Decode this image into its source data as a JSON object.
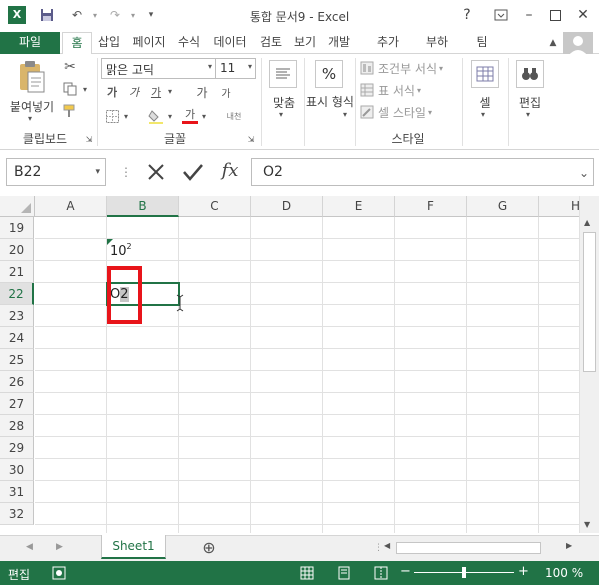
{
  "window": {
    "title": "통합 문서9 - Excel",
    "help_label": "?",
    "app_icon_label": "X"
  },
  "tabs": {
    "file": "파일",
    "items": [
      "홈",
      "삽입",
      "페이지",
      "수식",
      "데이터",
      "검토",
      "보기",
      "개발",
      "추가",
      "부하",
      "팀"
    ]
  },
  "ribbon": {
    "clipboard": {
      "paste_label": "붙여넣기",
      "group_label": "클립보드"
    },
    "font": {
      "font_name": "맑은 고딕",
      "font_size": "11",
      "bold": "가",
      "italic": "가",
      "underline": "가",
      "grow": "가",
      "shrink": "가",
      "font_color": "가",
      "phonetic": "내천",
      "group_label": "글꼴"
    },
    "alignment": {
      "label": "맞춤"
    },
    "number": {
      "symbol": "%",
      "label": "표시 형식"
    },
    "styles": {
      "conditional": "조건부 서식",
      "table": "표 서식",
      "cell_styles": "셀 스타일",
      "group_label": "스타일"
    },
    "cells": {
      "label": "셀"
    },
    "editing": {
      "label": "편집"
    }
  },
  "formula_bar": {
    "name_box": "B22",
    "fx_label": "fx",
    "content": "O2"
  },
  "grid": {
    "columns": [
      "A",
      "B",
      "C",
      "D",
      "E",
      "F",
      "G",
      "H"
    ],
    "rows": [
      "19",
      "20",
      "21",
      "22",
      "23",
      "24",
      "25",
      "26",
      "27",
      "28",
      "29",
      "30",
      "31",
      "32"
    ],
    "cell_b20": {
      "base": "10",
      "sup": "2"
    },
    "cell_b22": {
      "base": "O",
      "edit": "2"
    }
  },
  "sheets": {
    "active": "Sheet1",
    "add_label": "⊕"
  },
  "status": {
    "mode": "편집",
    "zoom": "100 %"
  },
  "colors": {
    "accent": "#217346",
    "highlight": "#e8141a"
  }
}
